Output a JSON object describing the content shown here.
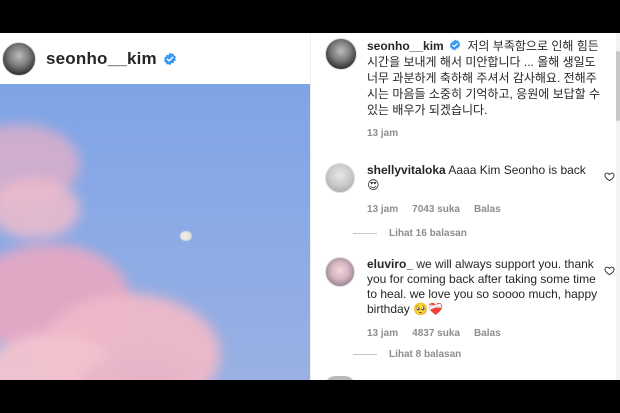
{
  "post": {
    "username": "seonho__kim",
    "caption_text": "저의 부족함으로 인해 힘든 시간을 보내게 해서 미안합니다 ... 올해 생일도 너무 과분하게 축하해 주셔서 감사해요. 전해주시는 마음들 소중히 기억하고, 응원에 보답할 수 있는 배우가 되겠습니다.",
    "time": "13 jam"
  },
  "comments": [
    {
      "username": "shellyvitaloka",
      "text": "Aaaa Kim Seonho is back",
      "emoji": "😍",
      "time": "13 jam",
      "likes": "7043 suka",
      "reply_label": "Balas",
      "view_replies": "Lihat 16 balasan"
    },
    {
      "username": "eluviro_",
      "text": "we will always support you. thank you for coming back after taking some time to heal. we love you so soooo much, happy birthday",
      "emoji": "🥺❤️‍🩹",
      "time": "13 jam",
      "likes": "4837 suka",
      "reply_label": "Balas",
      "view_replies": "Lihat 8 balasan"
    }
  ],
  "colors": {
    "verified": "#3897f0",
    "meta_text": "#8e8e8e",
    "sky": "#89a9e6",
    "cloud_pink": "#e9a8c2"
  },
  "icons": [
    "verified-badge-icon",
    "heart-icon"
  ]
}
